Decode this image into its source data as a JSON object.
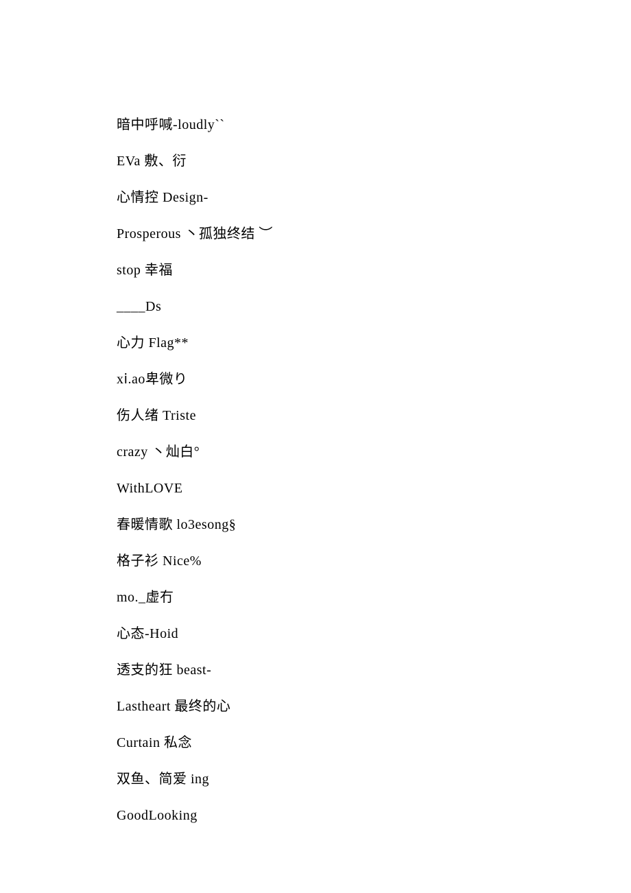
{
  "lines": [
    "暗中呼喊-loudly``",
    "EVa 敷、衍",
    "心情控 Design-",
    "Prosperous 丶孤独终结 ︶",
    "stop 幸福",
    "____Ds",
    "心力 Flag**",
    "xⅰ.aο卑微り",
    "伤人绪 Triste",
    "crazy 丶灿白°",
    "WithLOVE",
    "春暖情歌 lo3esong§",
    "格子衫 Nice%",
    "mo._虚冇",
    "心态-Hoid",
    "透支的狂 beast-",
    "Lastheart 最终的心",
    "Curtain 私念",
    "双鱼、简爱 ing",
    "GoodLooking"
  ]
}
